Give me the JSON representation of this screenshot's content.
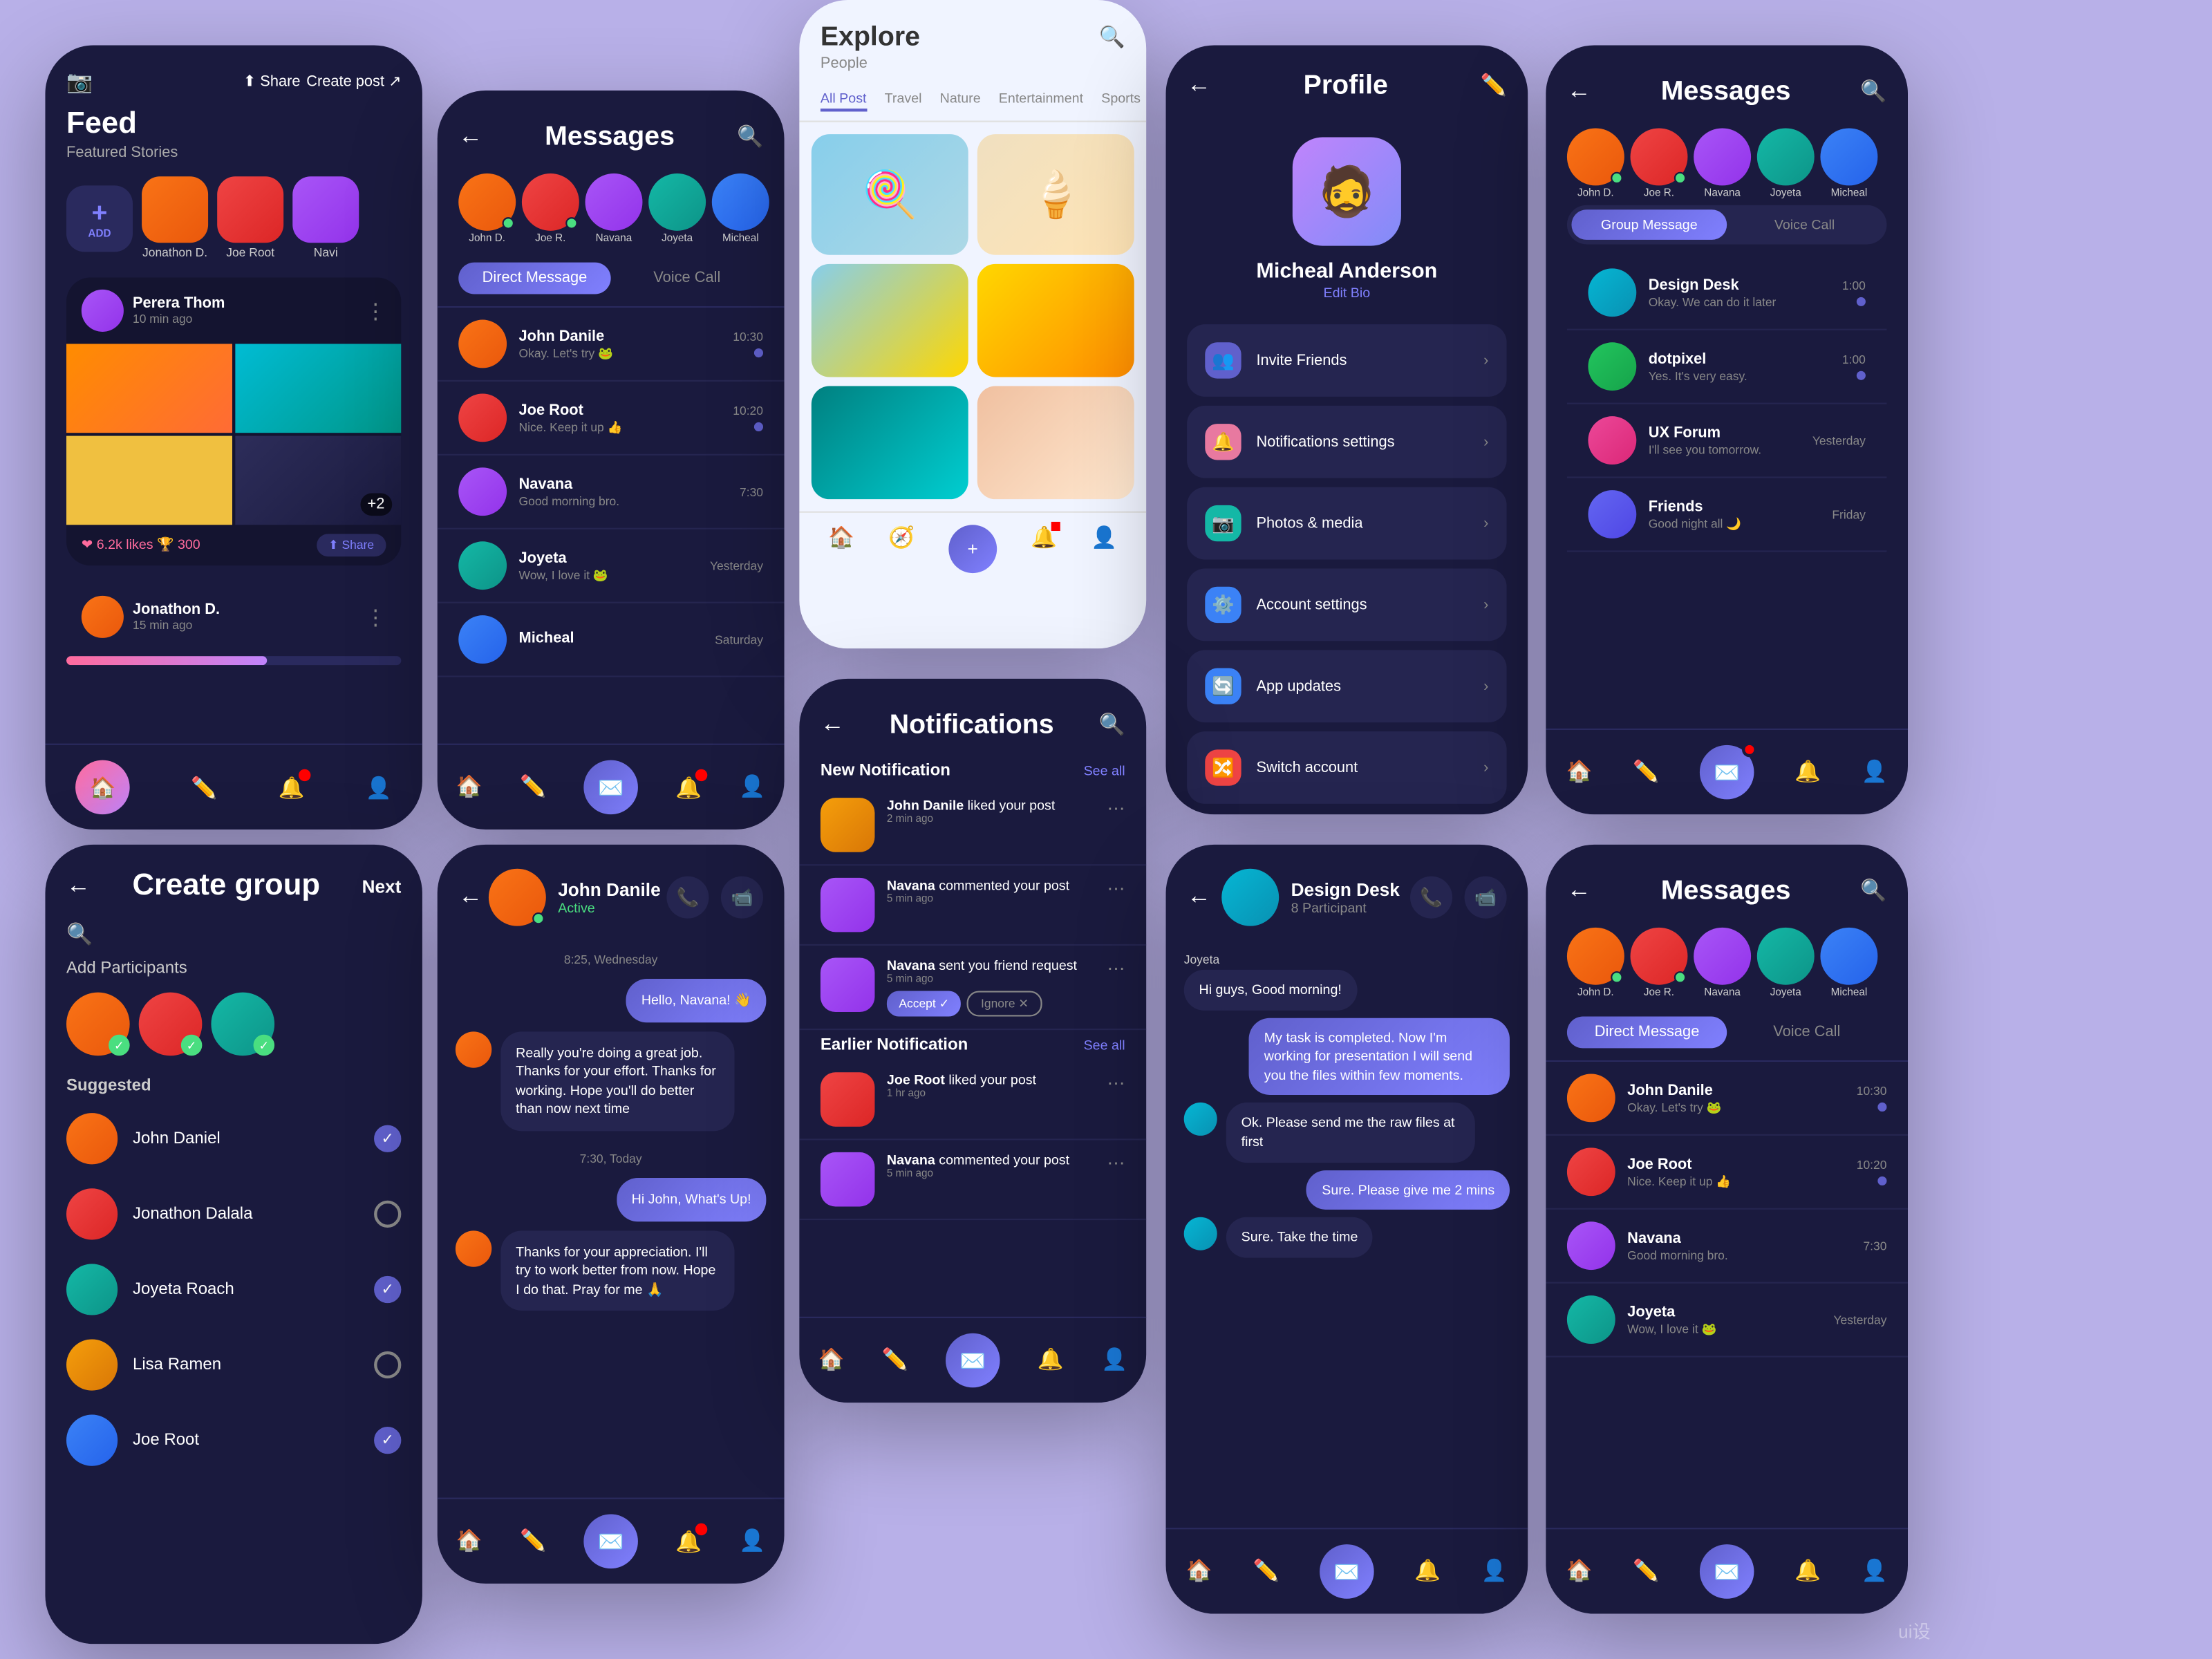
{
  "app": {
    "background": "#b8b0e8",
    "watermark": "ui设"
  },
  "feed_screen": {
    "title": "Feed",
    "featured_label": "Featured Stories",
    "add_label": "ADD +",
    "stories": [
      {
        "name": "Jonathon D.",
        "color": "av-orange"
      },
      {
        "name": "Joe Root",
        "color": "av-red"
      },
      {
        "name": "Navi",
        "color": "av-purple"
      }
    ],
    "post1": {
      "user": "Perera Thom",
      "time": "10 min ago",
      "stats": "❤ 6.2k likes  🏆 300",
      "share": "⬆ Share"
    },
    "post2": {
      "user": "Jonathon D.",
      "time": "15 min ago"
    },
    "nav_items": [
      "🏠",
      "✏️",
      "🔔",
      "👤"
    ]
  },
  "messages1_screen": {
    "title": "Messages",
    "tabs": [
      "Direct Message",
      "Voice Call"
    ],
    "contacts": [
      {
        "name": "John D.",
        "color": "av-orange"
      },
      {
        "name": "Joe R.",
        "color": "av-red"
      },
      {
        "name": "Navana",
        "color": "av-purple"
      },
      {
        "name": "Joyeta",
        "color": "av-teal"
      },
      {
        "name": "Micheal",
        "color": "av-blue"
      }
    ],
    "messages": [
      {
        "name": "John Danile",
        "preview": "Okay. Let's try 🐸",
        "time": "10:30",
        "color": "av-orange"
      },
      {
        "name": "Joe Root",
        "preview": "Nice. Keep it up 👍",
        "time": "10:20",
        "color": "av-red"
      },
      {
        "name": "Navana",
        "preview": "Good morning bro.",
        "time": "7:30",
        "color": "av-purple"
      },
      {
        "name": "Joyeta",
        "preview": "Wow, I love it 🐸",
        "time": "Yesterday",
        "color": "av-teal"
      },
      {
        "name": "Micheal",
        "preview": "",
        "time": "Saturday",
        "color": "av-blue"
      }
    ]
  },
  "explore_screen": {
    "title": "Explore",
    "subtitle": "People",
    "tabs": [
      "All Post",
      "Travel",
      "Nature",
      "Entertainment",
      "Sports"
    ],
    "active_tab": "All Post"
  },
  "profile_screen": {
    "title": "Profile",
    "user_name": "Micheal Anderson",
    "edit_bio": "Edit Bio",
    "menu_items": [
      {
        "icon": "👥",
        "label": "Invite Friends",
        "color": "purple"
      },
      {
        "icon": "🔔",
        "label": "Notifications settings",
        "color": "pink"
      },
      {
        "icon": "📷",
        "label": "Photos & media",
        "color": "teal-i"
      },
      {
        "icon": "⚙️",
        "label": "Account settings",
        "color": "blue"
      },
      {
        "icon": "🔄",
        "label": "App updates",
        "color": "blue"
      },
      {
        "icon": "🔀",
        "label": "Switch account",
        "color": "red"
      }
    ]
  },
  "messages2_screen": {
    "title": "Messages",
    "tabs": [
      "Group Message",
      "Voice Call"
    ],
    "contacts": [
      {
        "name": "John D.",
        "color": "av-orange"
      },
      {
        "name": "Joe R.",
        "color": "av-red"
      },
      {
        "name": "Navana",
        "color": "av-purple"
      },
      {
        "name": "Joyeta",
        "color": "av-teal"
      },
      {
        "name": "Micheal",
        "color": "av-blue"
      }
    ],
    "messages": [
      {
        "name": "Design Desk",
        "preview": "Okay. We can do it later",
        "time": "1:00",
        "color": "av-cyan"
      },
      {
        "name": "dotpixel",
        "preview": "Yes. It's very easy.",
        "time": "1:00",
        "color": "av-green"
      },
      {
        "name": "UX Forum",
        "preview": "I'll see you tomorrow.",
        "time": "Yesterday",
        "color": "av-pink"
      },
      {
        "name": "Friends",
        "preview": "Good night all 🌙",
        "time": "Friday",
        "color": "av-indigo"
      }
    ]
  },
  "create_group_screen": {
    "title": "Create group",
    "next_label": "Next",
    "add_label": "Add Participants",
    "suggested_label": "Suggested",
    "selected": [
      {
        "color": "av-orange",
        "checked": true
      },
      {
        "color": "av-red",
        "checked": true
      },
      {
        "color": "av-teal",
        "checked": true
      }
    ],
    "persons": [
      {
        "name": "John Daniel",
        "color": "av-orange",
        "checked": true
      },
      {
        "name": "Jonathon Dalala",
        "color": "av-red",
        "checked": false
      },
      {
        "name": "Joyeta Roach",
        "color": "av-teal",
        "checked": true
      },
      {
        "name": "Lisa Ramen",
        "color": "av-yellow-av",
        "checked": false
      },
      {
        "name": "Joe Root",
        "color": "av-blue",
        "checked": true
      }
    ]
  },
  "chat_screen": {
    "contact_name": "John Danile",
    "status": "Active",
    "date_label": "8:25, Wednesday",
    "messages": [
      {
        "text": "Hello, Navana! 👋",
        "type": "sent"
      },
      {
        "text": "Really you're doing a great job. Thanks for your effort. Thanks for working. Hope you'll do better than now next time",
        "type": "received"
      },
      {
        "date": "7:30, Today"
      },
      {
        "text": "Hi John, What's Up!",
        "type": "sent"
      },
      {
        "text": "Thanks for your appreciation. I'll try to work better from now. Hope I do that. Pray for me 🙏",
        "type": "received"
      }
    ]
  },
  "notifications_screen": {
    "title": "Notifications",
    "new_section": "New Notification",
    "earlier_section": "Earlier Notification",
    "see_all": "See all",
    "new_items": [
      {
        "user": "John Danile",
        "action": "liked your post",
        "time": "2 min ago",
        "color": "av-orange"
      },
      {
        "user": "Navana",
        "action": "commented your post",
        "time": "5 min ago",
        "color": "av-purple"
      },
      {
        "user": "Navana",
        "action": "sent you friend request",
        "time": "5 min ago",
        "color": "av-purple",
        "has_actions": true
      }
    ],
    "earlier_items": [
      {
        "user": "Joe Root",
        "action": "liked your post",
        "time": "1 hr ago",
        "color": "av-red"
      },
      {
        "user": "Navana",
        "action": "commented your post",
        "time": "5 min ago",
        "color": "av-purple"
      }
    ],
    "accept_label": "Accept ✓",
    "ignore_label": "Ignore ✕"
  },
  "group_chat_screen": {
    "contact_name": "Design Desk",
    "participants": "8 Participant",
    "messages": [
      {
        "sender": "Joyeta",
        "text": "Hi guys, Good morning!",
        "type": "received"
      },
      {
        "text": "My task is completed. Now I'm working for presentation I will send you the files within few moments.",
        "type": "sent"
      },
      {
        "text": "Ok. Please send me the raw files at first",
        "type": "received"
      },
      {
        "text": "Sure. Please give me 2 mins",
        "type": "sent"
      },
      {
        "text": "Sure. Take the time",
        "type": "received"
      }
    ]
  },
  "messages3_screen": {
    "title": "Messages",
    "tabs": [
      "Direct Message",
      "Voice Call"
    ],
    "contacts": [
      {
        "name": "John D.",
        "color": "av-orange"
      },
      {
        "name": "Joe R.",
        "color": "av-red"
      },
      {
        "name": "Navana",
        "color": "av-purple"
      },
      {
        "name": "Joyeta",
        "color": "av-teal"
      },
      {
        "name": "Micheal",
        "color": "av-blue"
      }
    ],
    "messages": [
      {
        "name": "John Danile",
        "preview": "Okay. Let's try 🐸",
        "time": "10:30",
        "color": "av-orange"
      },
      {
        "name": "Joe Root",
        "preview": "Nice. Keep it up 👍",
        "time": "10:20",
        "color": "av-red"
      },
      {
        "name": "Navana",
        "preview": "Good morning bro.",
        "time": "7:30",
        "color": "av-purple"
      },
      {
        "name": "Joyeta",
        "preview": "Wow, I love it 🐸",
        "time": "Yesterday",
        "color": "av-teal"
      }
    ]
  }
}
